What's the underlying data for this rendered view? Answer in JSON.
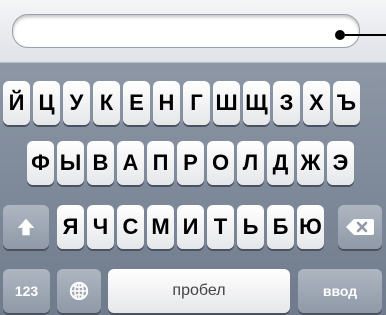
{
  "text_field": {
    "value": ""
  },
  "keyboard": {
    "row1": [
      "Й",
      "Ц",
      "У",
      "К",
      "Е",
      "Н",
      "Г",
      "Ш",
      "Щ",
      "З",
      "Х",
      "Ъ"
    ],
    "row2": [
      "Ф",
      "Ы",
      "В",
      "А",
      "П",
      "Р",
      "О",
      "Л",
      "Д",
      "Ж",
      "Э"
    ],
    "row3": [
      "Я",
      "Ч",
      "С",
      "М",
      "И",
      "Т",
      "Ь",
      "Б",
      "Ю"
    ],
    "shift_icon": "shift-arrow",
    "backspace_icon": "backspace-x",
    "numbers_label": "123",
    "globe_icon": "globe",
    "space_label": "пробел",
    "enter_label": "ввод"
  }
}
